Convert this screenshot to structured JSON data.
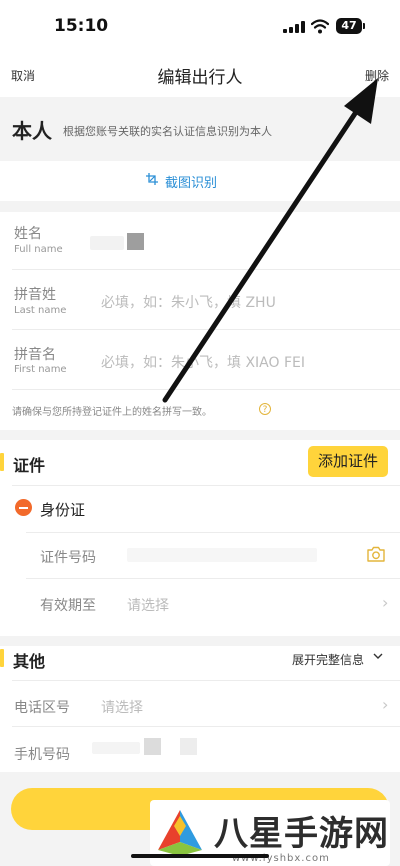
{
  "status_bar": {
    "time": "15:10",
    "battery": "47"
  },
  "nav": {
    "cancel": "取消",
    "title": "编辑出行人",
    "delete": "删除"
  },
  "self_banner": {
    "label": "本人",
    "description": "根据您账号关联的实名认证信息识别为本人"
  },
  "ocr": {
    "label": "截图识别"
  },
  "form": {
    "name": {
      "label_zh": "姓名",
      "label_en": "Full name"
    },
    "last_name": {
      "label_zh": "拼音姓",
      "label_en": "Last name",
      "placeholder": "必填，如：朱小飞，填 ZHU"
    },
    "first_name": {
      "label_zh": "拼音名",
      "label_en": "First name",
      "placeholder": "必填，如：朱小飞，填 XIAO FEI"
    },
    "hint": "请确保与您所持登记证件上的姓名拼写一致。"
  },
  "certificate": {
    "title": "证件",
    "add_button": "添加证件",
    "id_type": "身份证",
    "number_label": "证件号码",
    "validity_label": "有效期至",
    "validity_placeholder": "请选择"
  },
  "other": {
    "title": "其他",
    "expand": "展开完整信息",
    "area_code_label": "电话区号",
    "area_code_placeholder": "请选择",
    "mobile_label": "手机号码"
  },
  "watermark": {
    "text": "八星手游网",
    "url": "www.lyshbx.com"
  },
  "colors": {
    "accent_yellow": "#ffd43b",
    "link_blue": "#2b8fd6",
    "remove_orange": "#f26a2b"
  }
}
